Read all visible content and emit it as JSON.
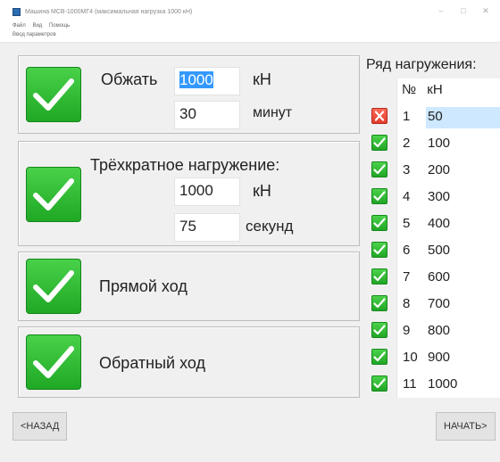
{
  "window": {
    "title": "Машина МСВ-1000МГ4 (максимальная нагрузка 1000 кН)",
    "menu": [
      "Файл",
      "Вид",
      "Помощь"
    ],
    "submenu": "Ввод параметров"
  },
  "groups": {
    "compress": {
      "label": "Обжать",
      "force_value": "1000",
      "force_unit": "кН",
      "time_value": "30",
      "time_unit": "минут"
    },
    "triple": {
      "label": "Трёхкратное нагружение:",
      "force_value": "1000",
      "force_unit": "кН",
      "time_value": "75",
      "time_unit": "секунд"
    },
    "forward": {
      "label": "Прямой ход"
    },
    "reverse": {
      "label": "Обратный ход"
    }
  },
  "series": {
    "title": "Ряд нагружения:",
    "header_num": "№",
    "header_unit": "кН",
    "rows": [
      {
        "num": "1",
        "value": "50",
        "status": "error"
      },
      {
        "num": "2",
        "value": "100",
        "status": "ok"
      },
      {
        "num": "3",
        "value": "200",
        "status": "ok"
      },
      {
        "num": "4",
        "value": "300",
        "status": "ok"
      },
      {
        "num": "5",
        "value": "400",
        "status": "ok"
      },
      {
        "num": "6",
        "value": "500",
        "status": "ok"
      },
      {
        "num": "7",
        "value": "600",
        "status": "ok"
      },
      {
        "num": "8",
        "value": "700",
        "status": "ok"
      },
      {
        "num": "9",
        "value": "800",
        "status": "ok"
      },
      {
        "num": "10",
        "value": "900",
        "status": "ok"
      },
      {
        "num": "11",
        "value": "1000",
        "status": "ok"
      }
    ]
  },
  "buttons": {
    "back": "<НАЗАД",
    "start": "НАЧАТЬ>"
  },
  "colors": {
    "check_green": "#21a526",
    "error_red": "#e33b2a",
    "selection_blue": "#3399ff"
  }
}
